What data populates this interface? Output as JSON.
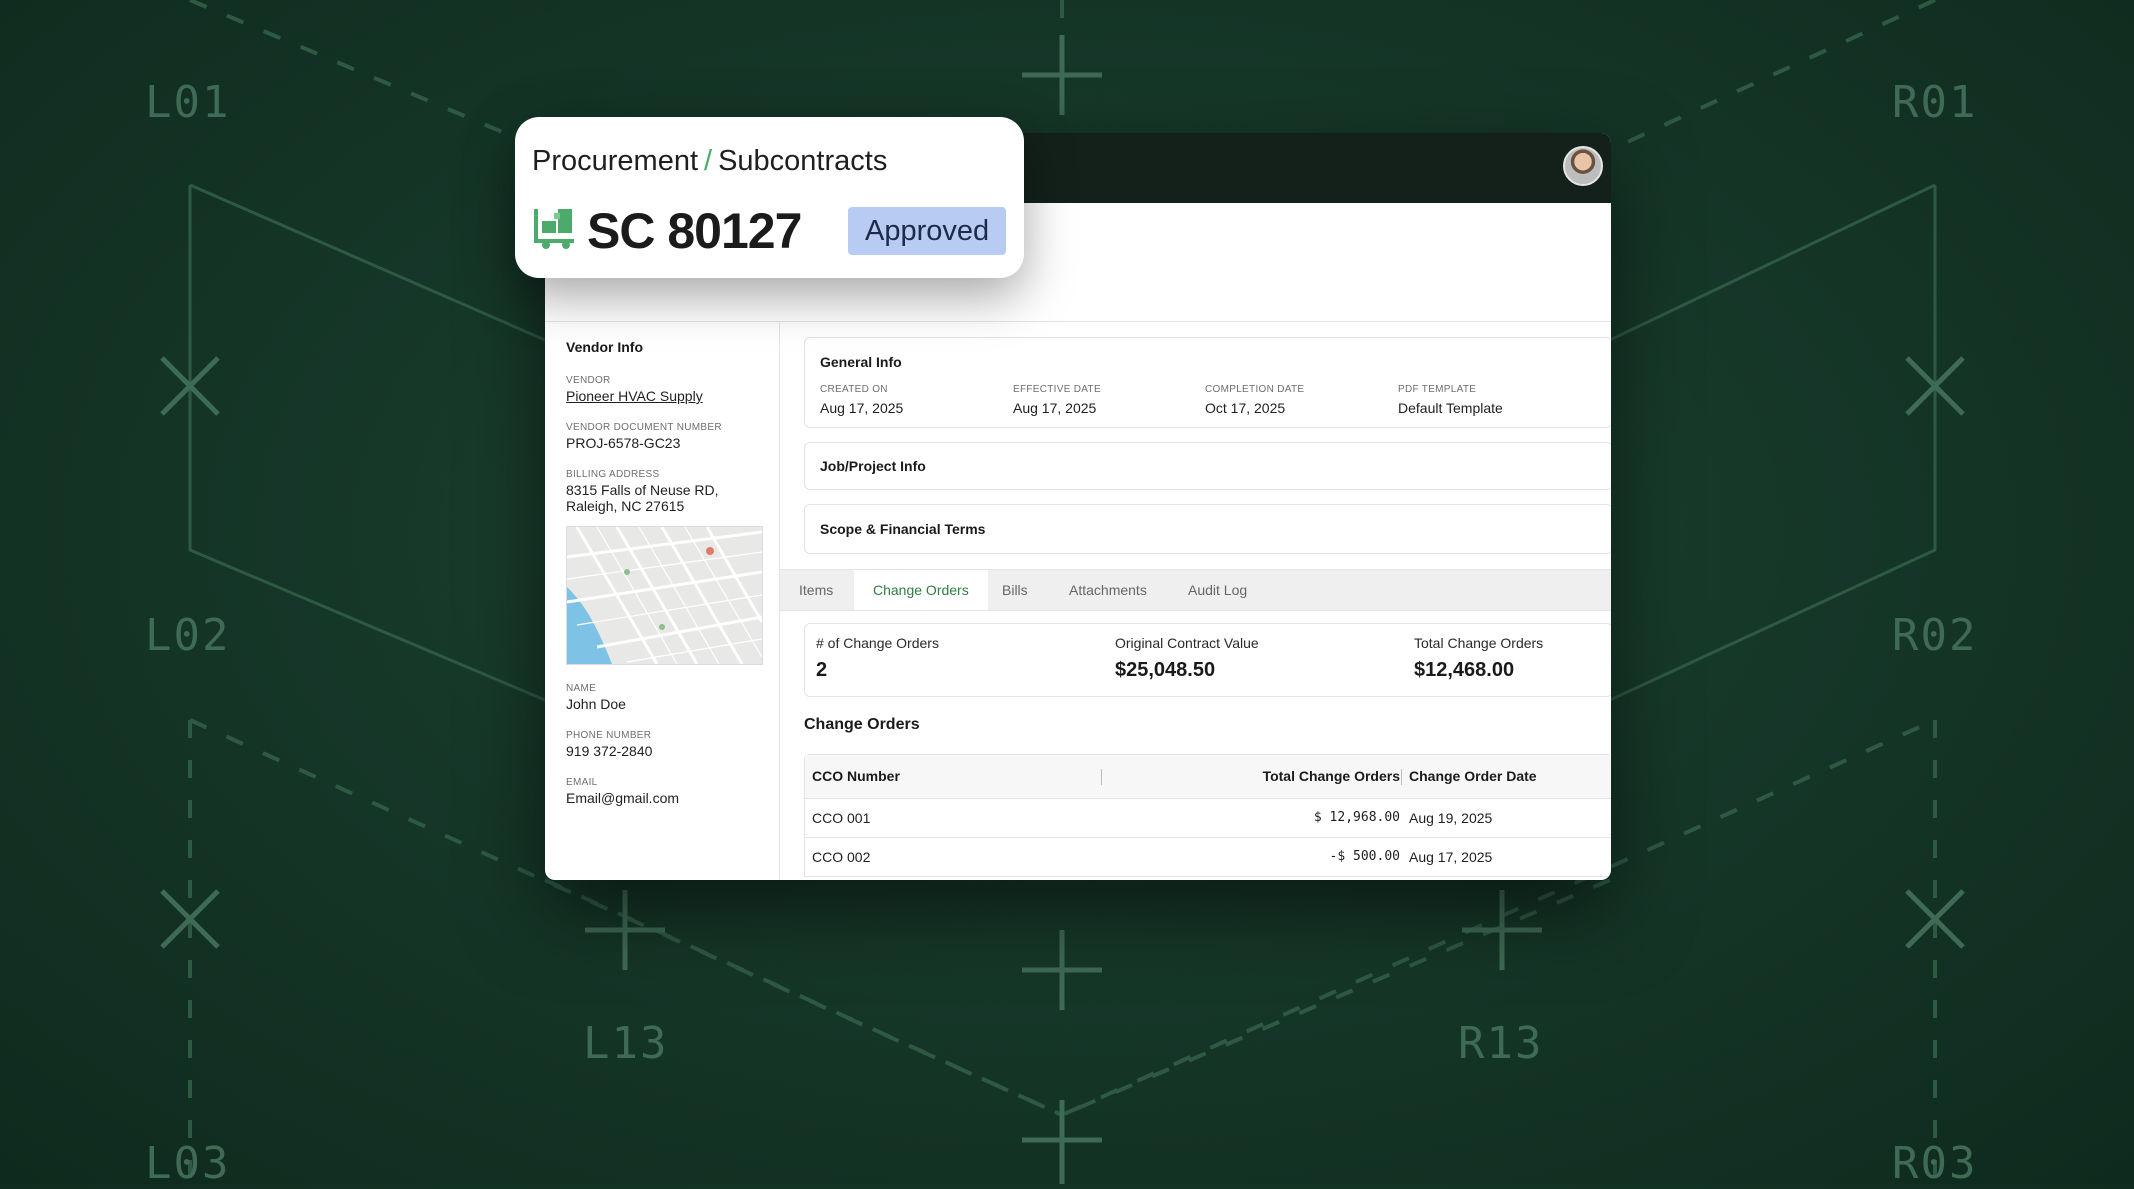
{
  "background": {
    "grid_labels": [
      "L01",
      "R01",
      "L02",
      "R02",
      "L13",
      "R13",
      "L03",
      "R03"
    ]
  },
  "header": {
    "breadcrumb": [
      "Procurement",
      "Subcontracts"
    ],
    "breadcrumb_separator": "/",
    "document_id": "SC 80127",
    "status": "Approved",
    "icon": "forklift-icon",
    "accent_color": "#4caa6a",
    "status_color": "#b8cbf2"
  },
  "sidebar": {
    "title": "Vendor Info",
    "vendor_label": "VENDOR",
    "vendor": "Pioneer HVAC Supply",
    "vendor_doc_label": "VENDOR DOCUMENT NUMBER",
    "vendor_doc": "PROJ-6578-GC23",
    "billing_label": "BILLING ADDRESS",
    "billing_line1": "8315 Falls of Neuse RD,",
    "billing_line2": "Raleigh, NC 27615",
    "name_label": "NAME",
    "name": "John Doe",
    "phone_label": "PHONE NUMBER",
    "phone": "919 372-2840",
    "email_label": "EMAIL",
    "email": "Email@gmail.com"
  },
  "general_info": {
    "title": "General Info",
    "fields": [
      {
        "label": "CREATED ON",
        "value": "Aug 17, 2025"
      },
      {
        "label": "EFFECTIVE DATE",
        "value": "Aug 17, 2025"
      },
      {
        "label": "COMPLETION DATE",
        "value": "Oct 17, 2025"
      },
      {
        "label": "PDF TEMPLATE",
        "value": "Default Template"
      }
    ]
  },
  "sections": {
    "job_project": "Job/Project Info",
    "scope_financial": "Scope & Financial Terms"
  },
  "tabs": [
    "Items",
    "Change Orders",
    "Bills",
    "Attachments",
    "Audit Log"
  ],
  "active_tab": "Change Orders",
  "summary": [
    {
      "label": "# of Change Orders",
      "value": "2"
    },
    {
      "label": "Original Contract Value",
      "value": "$25,048.50"
    },
    {
      "label": "Total Change Orders",
      "value": "$12,468.00"
    }
  ],
  "change_orders": {
    "heading": "Change Orders",
    "columns": [
      "CCO Number",
      "Total Change Orders",
      "Change Order Date"
    ],
    "rows": [
      {
        "number": "CCO 001",
        "total": "$ 12,968.00",
        "date": "Aug 19, 2025"
      },
      {
        "number": "CCO 002",
        "total": "-$ 500.00",
        "date": "Aug 17, 2025"
      }
    ]
  }
}
